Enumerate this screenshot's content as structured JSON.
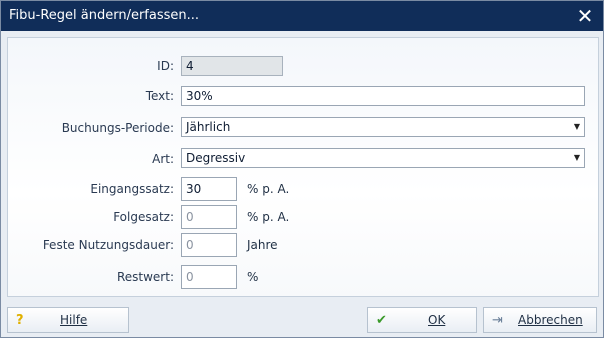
{
  "window": {
    "title": "Fibu-Regel ändern/erfassen...",
    "close_glyph": "✕"
  },
  "form": {
    "id": {
      "label": "ID:",
      "value": "4"
    },
    "text": {
      "label": "Text:",
      "value": "30%"
    },
    "period": {
      "label": "Buchungs-Periode:",
      "value": "Jährlich"
    },
    "type": {
      "label": "Art:",
      "value": "Degressiv"
    },
    "initial_rate": {
      "label": "Eingangssatz:",
      "value": "30",
      "unit": "% p. A."
    },
    "follow_rate": {
      "label": "Folgesatz:",
      "value": "0",
      "unit": "% p. A."
    },
    "fixed_life": {
      "label": "Feste Nutzungsdauer:",
      "value": "0",
      "unit": "Jahre"
    },
    "residual": {
      "label": "Restwert:",
      "value": "0",
      "unit": "%"
    }
  },
  "footer": {
    "help": {
      "label": "Hilfe",
      "icon": "question-icon",
      "glyph": "?"
    },
    "ok": {
      "label": "OK",
      "icon": "checkmark-icon",
      "glyph": "✔"
    },
    "cancel": {
      "label": "Abbrechen",
      "icon": "exit-door-icon",
      "glyph": "⇥"
    }
  },
  "colors": {
    "titlebar": "#102d59",
    "accent_green": "#3a9a2a",
    "help_yellow": "#e0b000"
  }
}
